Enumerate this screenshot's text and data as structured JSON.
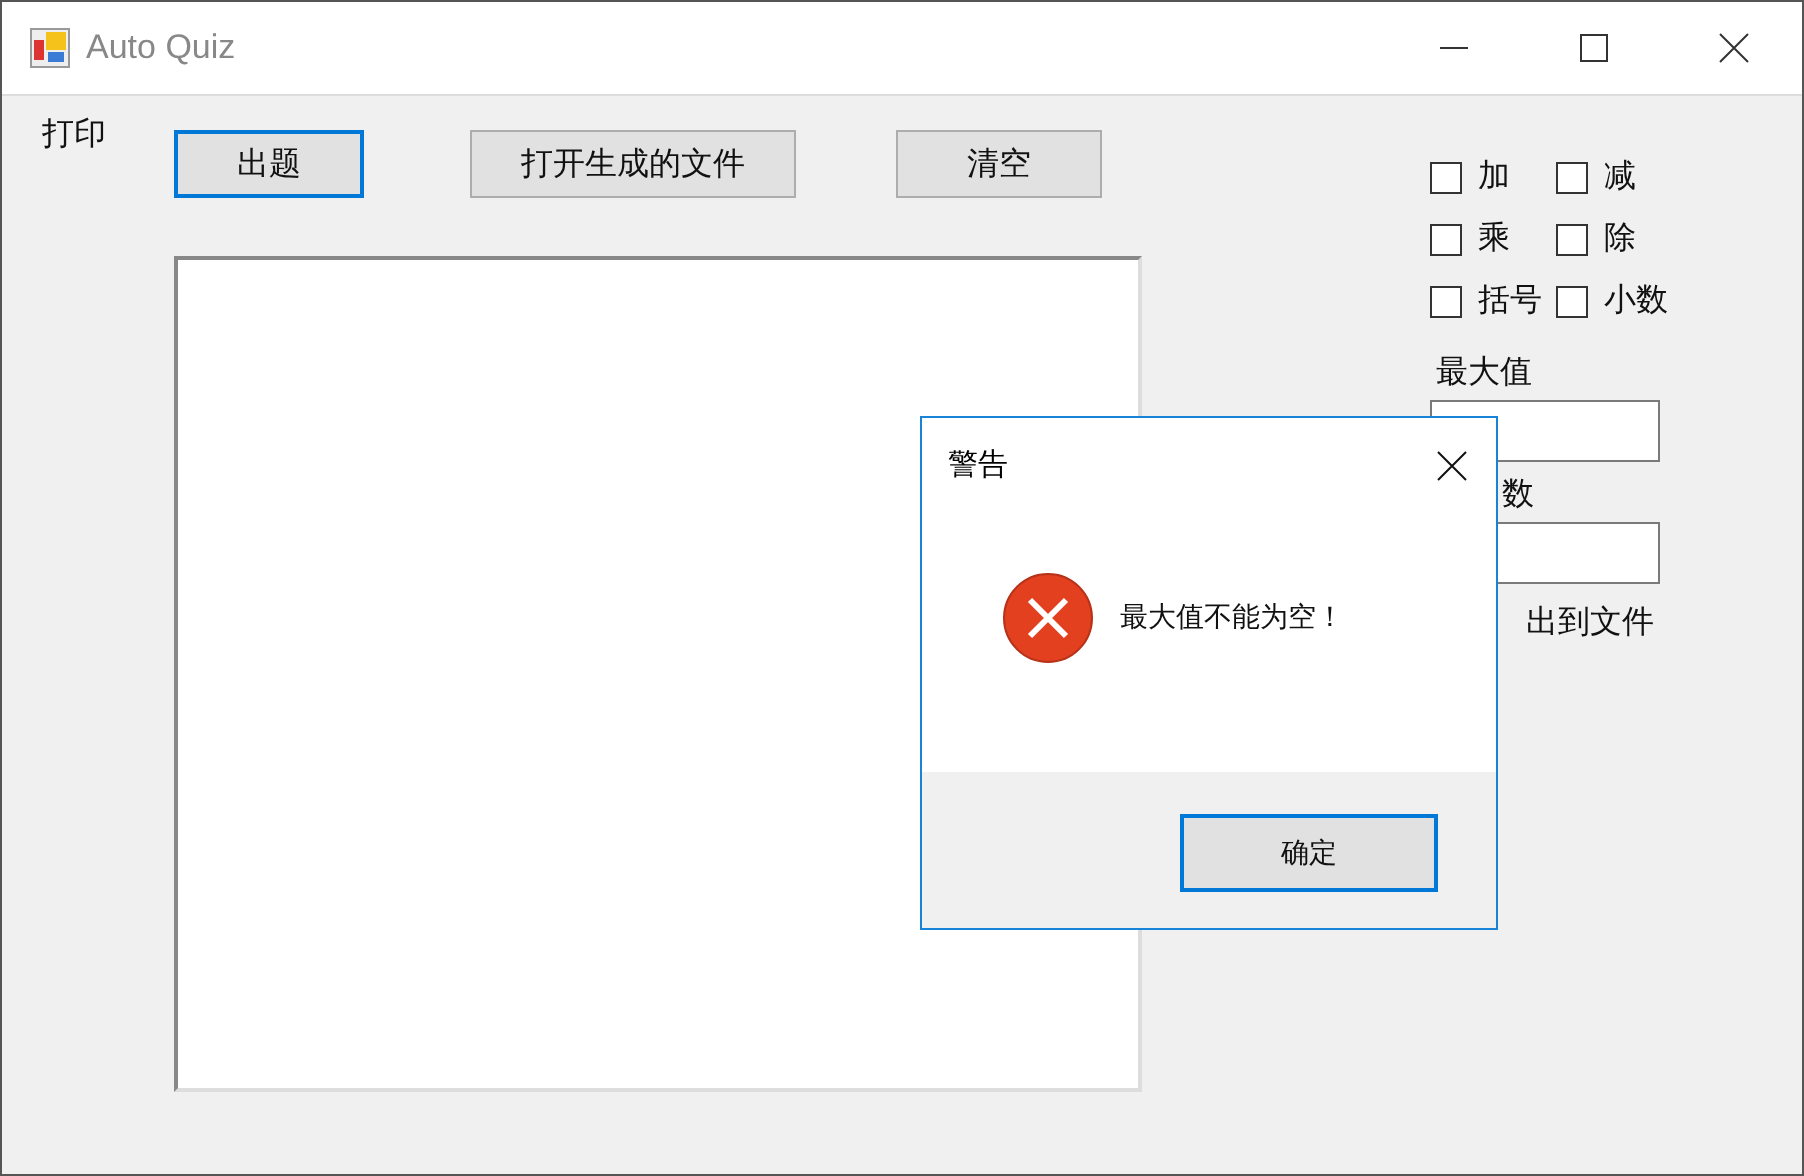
{
  "window": {
    "title": "Auto Quiz"
  },
  "menu": [
    {
      "label": "打印"
    }
  ],
  "buttons": [
    {
      "label": "出题",
      "focused": true
    },
    {
      "label": "打开生成的文件",
      "focused": false
    },
    {
      "label": "清空",
      "focused": false
    }
  ],
  "options": [
    {
      "label": "加",
      "checked": false
    },
    {
      "label": "减",
      "checked": false
    },
    {
      "label": "乘",
      "checked": false
    },
    {
      "label": "除",
      "checked": false
    },
    {
      "label": "括号",
      "checked": false
    },
    {
      "label": "小数",
      "checked": false
    }
  ],
  "fields": [
    {
      "label": "最大值"
    },
    {
      "label": "数"
    }
  ],
  "output_option": {
    "label": "出到文件"
  },
  "dialog": {
    "title": "警告",
    "message": "最大值不能为空！",
    "buttons": [
      {
        "label": "确定",
        "focused": true
      }
    ]
  }
}
